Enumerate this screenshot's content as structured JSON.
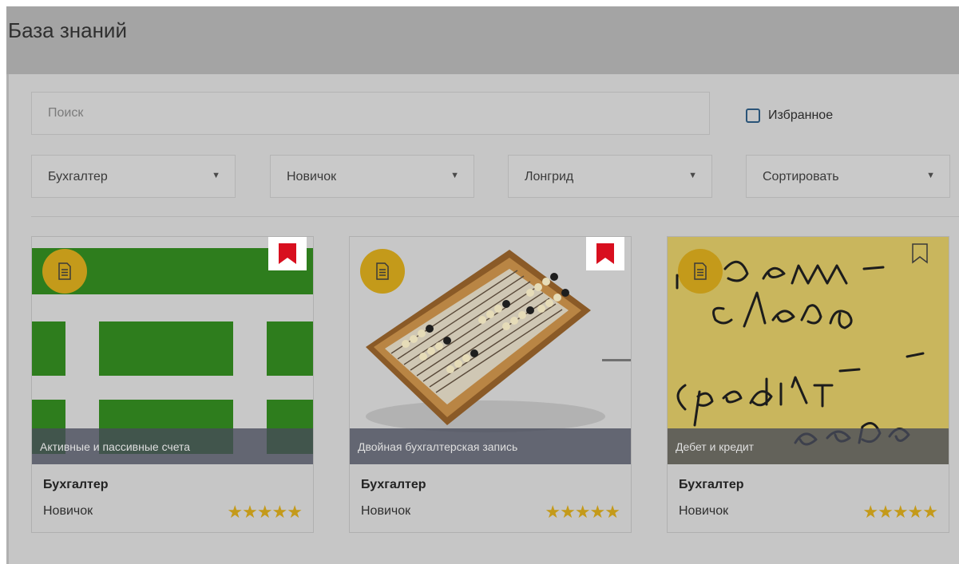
{
  "page": {
    "title": "База знаний"
  },
  "search": {
    "placeholder": "Поиск",
    "value": ""
  },
  "favorites": {
    "label": "Избранное",
    "checked": false
  },
  "filters": [
    {
      "label": "Бухгалтер"
    },
    {
      "label": "Новичок"
    },
    {
      "label": "Лонгрид"
    },
    {
      "label": "Сортировать"
    }
  ],
  "cards": [
    {
      "caption": "Активные и пассивные счета",
      "role": "Бухгалтер",
      "level": "Новичок",
      "rating": 5,
      "stars": "★★★★★",
      "bookmarked": true,
      "type_icon": "document-icon"
    },
    {
      "caption": "Двойная бухгалтерская запись",
      "role": "Бухгалтер",
      "level": "Новичок",
      "rating": 5,
      "stars": "★★★★★",
      "bookmarked": true,
      "type_icon": "document-icon"
    },
    {
      "caption": "Дебет и кредит",
      "role": "Бухгалтер",
      "level": "Новичок",
      "rating": 5,
      "stars": "★★★★★",
      "bookmarked": false,
      "type_icon": "document-icon"
    }
  ],
  "colors": {
    "accent_gold": "#c49a1a",
    "bookmark_red": "#d80f1f",
    "checkbox_blue": "#2a5478",
    "caption_bg": "#464a5a"
  }
}
